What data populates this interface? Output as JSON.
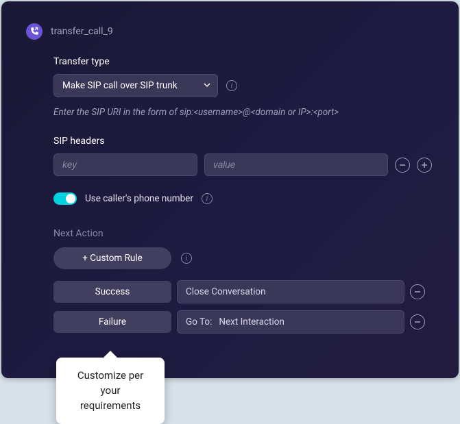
{
  "node": {
    "title": "transfer_call_9",
    "icon": "phone-transfer-icon"
  },
  "transfer_type": {
    "label": "Transfer type",
    "selected": "Make SIP call over SIP trunk",
    "hint": "Enter the SIP URI in the form of sip:<username>@<domain or IP>:<port>"
  },
  "sip_headers": {
    "label": "SIP headers",
    "key_placeholder": "key",
    "value_placeholder": "value"
  },
  "use_caller": {
    "label": "Use caller's phone number",
    "enabled": true
  },
  "next_action": {
    "label": "Next Action",
    "custom_rule_label": "+ Custom Rule",
    "rows": [
      {
        "label": "Success",
        "value": "Close Conversation",
        "goto_prefix": ""
      },
      {
        "label": "Failure",
        "value": "Next Interaction",
        "goto_prefix": "Go To:"
      }
    ]
  },
  "tooltip": {
    "text": "Customize per your requirements"
  }
}
